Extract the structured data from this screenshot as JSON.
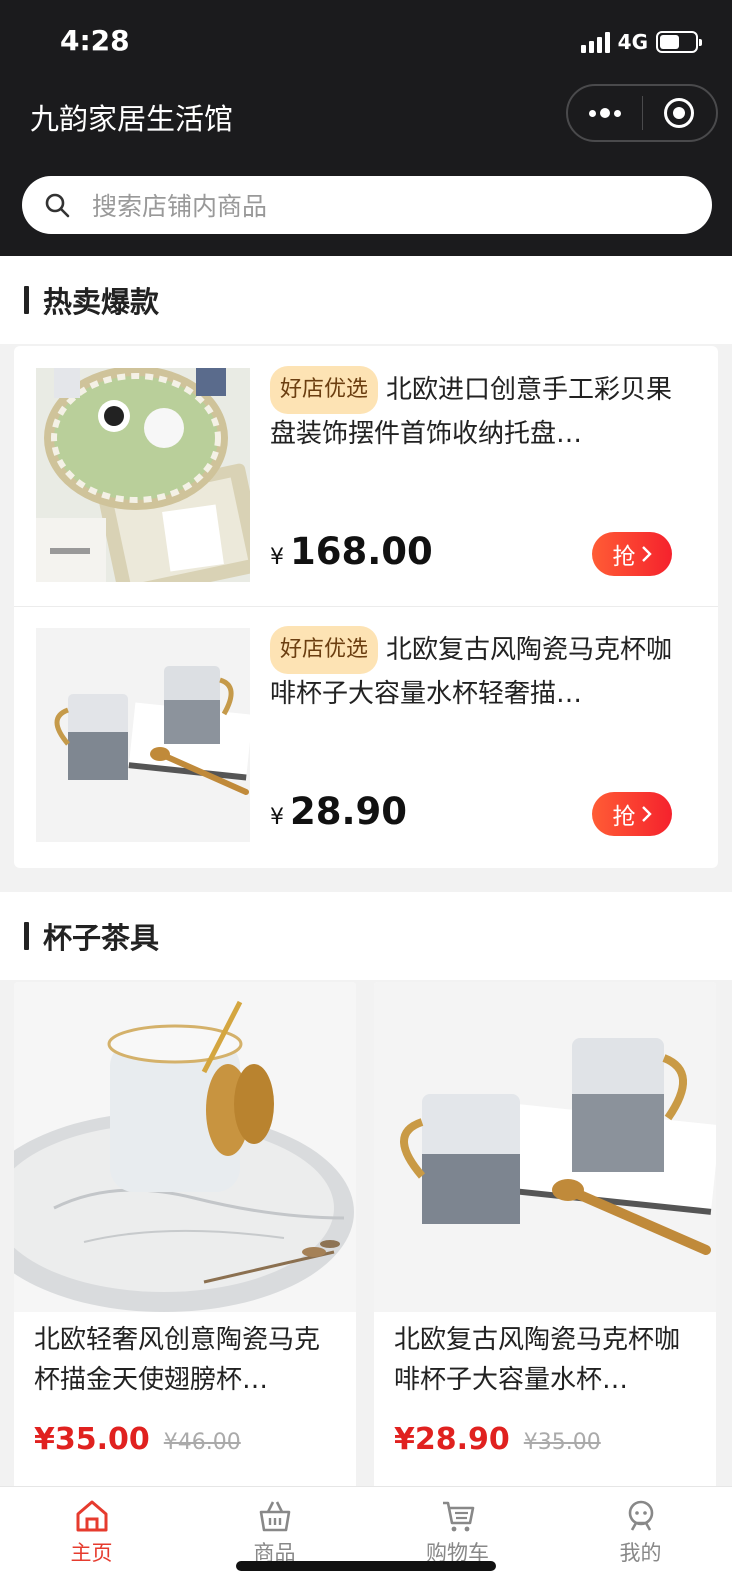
{
  "status_bar": {
    "time": "4:28",
    "network": "4G",
    "battery_level": 0.55
  },
  "header": {
    "title": "九韵家居生活馆"
  },
  "search": {
    "placeholder": "搜索店铺内商品"
  },
  "sections": {
    "hot": {
      "title": "热卖爆款"
    },
    "cups": {
      "title": "杯子茶具"
    }
  },
  "hot_items": [
    {
      "tag": "好店优选",
      "title": "北欧进口创意手工彩贝果盘装饰摆件首饰收纳托盘…",
      "currency": "¥",
      "price": "168.00",
      "button": "抢"
    },
    {
      "tag": "好店优选",
      "title": "北欧复古风陶瓷马克杯咖啡杯子大容量水杯轻奢描…",
      "currency": "¥",
      "price": "28.90",
      "button": "抢"
    }
  ],
  "grid_items": [
    {
      "title": "北欧轻奢风创意陶瓷马克杯描金天使翅膀杯…",
      "price": "¥35.00",
      "original_price": "¥46.00"
    },
    {
      "title": "北欧复古风陶瓷马克杯咖啡杯子大容量水杯…",
      "price": "¥28.90",
      "original_price": "¥35.00"
    }
  ],
  "tabbar": {
    "items": [
      {
        "label": "主页",
        "icon": "home-icon",
        "active": true
      },
      {
        "label": "商品",
        "icon": "basket-icon",
        "active": false
      },
      {
        "label": "购物车",
        "icon": "cart-icon",
        "active": false
      },
      {
        "label": "我的",
        "icon": "profile-icon",
        "active": false
      }
    ]
  },
  "colors": {
    "accent": "#e63b2e",
    "price_red": "#e0211f",
    "header_bg": "#1b1b1d",
    "tag_bg": "#fde3b4"
  }
}
